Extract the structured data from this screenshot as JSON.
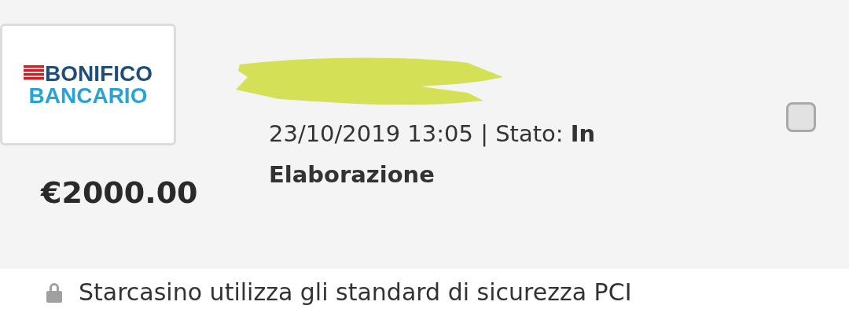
{
  "transaction": {
    "logo": {
      "line_1": "BONIFICO",
      "line_2": "BANCARIO"
    },
    "amount": "€2000.00",
    "details": "23/10/2019 13:05 | Stato: **In Elaborazione**",
    "checked": false
  },
  "footer": {
    "text": "Starcasino utilizza gli standard di sicurezza PCI"
  }
}
